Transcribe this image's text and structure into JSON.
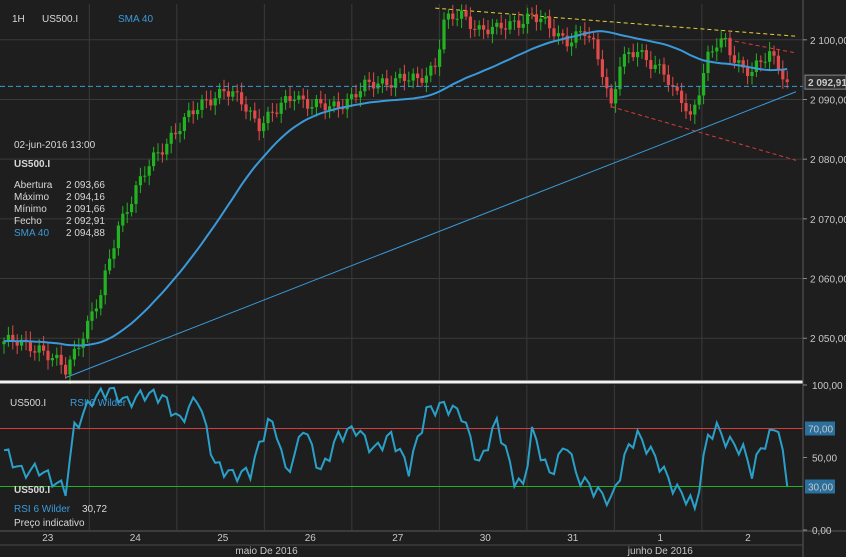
{
  "chart_data": [
    {
      "type": "candlestick",
      "timeframe": "1H",
      "symbol": "US500.I",
      "indicator": "SMA 40",
      "ylim": [
        2043,
        2106
      ],
      "yticks": [
        "2 100,00",
        "2 090,00",
        "2 080,00",
        "2 070,00",
        "2 060,00",
        "2 050,00"
      ],
      "ytick_values": [
        2100,
        2090,
        2080,
        2070,
        2060,
        2050
      ],
      "last_price_label": "2 092,91",
      "last_price": 2092.91,
      "reference_level": 2092.2,
      "x_day_labels": [
        "23",
        "24",
        "25",
        "26",
        "27",
        "30",
        "31",
        "1",
        "2"
      ],
      "x_month_labels": [
        "maio De 2016",
        "junho De 2016"
      ],
      "close_anchors": [
        [
          0,
          2049.5
        ],
        [
          8,
          2048.5
        ],
        [
          14,
          2044.5
        ],
        [
          18,
          2051
        ],
        [
          22,
          2057
        ],
        [
          26,
          2069
        ],
        [
          30,
          2075
        ],
        [
          34,
          2080
        ],
        [
          38,
          2084
        ],
        [
          42,
          2087
        ],
        [
          46,
          2090
        ],
        [
          50,
          2091.5
        ],
        [
          54,
          2089.5
        ],
        [
          58,
          2086
        ],
        [
          62,
          2088
        ],
        [
          66,
          2091
        ],
        [
          70,
          2089
        ],
        [
          74,
          2088.5
        ],
        [
          78,
          2090
        ],
        [
          82,
          2092
        ],
        [
          86,
          2093
        ],
        [
          90,
          2093.5
        ],
        [
          94,
          2093
        ],
        [
          98,
          2096
        ],
        [
          100,
          2103
        ],
        [
          104,
          2104
        ],
        [
          108,
          2102
        ],
        [
          112,
          2101.5
        ],
        [
          116,
          2103
        ],
        [
          120,
          2104
        ],
        [
          124,
          2102
        ],
        [
          128,
          2100
        ],
        [
          132,
          2101
        ],
        [
          134,
          2099
        ],
        [
          136,
          2095
        ],
        [
          138,
          2089
        ],
        [
          140,
          2096
        ],
        [
          144,
          2098
        ],
        [
          148,
          2096
        ],
        [
          150,
          2094.5
        ],
        [
          152,
          2091
        ],
        [
          154,
          2090
        ],
        [
          156,
          2087
        ],
        [
          158,
          2092
        ],
        [
          160,
          2097
        ],
        [
          162,
          2099
        ],
        [
          164,
          2099.5
        ],
        [
          166,
          2097
        ],
        [
          168,
          2095.5
        ],
        [
          170,
          2094.5
        ],
        [
          172,
          2096
        ],
        [
          174,
          2097.5
        ],
        [
          176,
          2096
        ],
        [
          178,
          2092.9
        ]
      ],
      "trendlines": [
        {
          "color": "#e6d23a",
          "style": "dashed",
          "from": [
            98,
            2105.3
          ],
          "to": [
            180,
            2100.6
          ]
        },
        {
          "color": "#d93a3a",
          "style": "dashed",
          "from": [
            163,
            2100.2
          ],
          "to": [
            180,
            2097.8
          ]
        },
        {
          "color": "#d93a3a",
          "style": "dashed",
          "from": [
            138,
            2088.8
          ],
          "to": [
            180,
            2079.8
          ]
        },
        {
          "color": "#3a9ad9",
          "style": "solid",
          "from": [
            14,
            2043.4
          ],
          "to": [
            180,
            2091.3
          ]
        }
      ],
      "series_colors": {
        "up": "#22b322",
        "down": "#e04a4a",
        "sma": "#3a9ad9"
      }
    },
    {
      "type": "line",
      "indicator": "RSI 6 Wilder",
      "symbol": "US500.I",
      "ylim": [
        0,
        100
      ],
      "yticks": [
        "100,00",
        "50,00",
        "0,00"
      ],
      "ytick_values": [
        100,
        50,
        0
      ],
      "levels": [
        {
          "value": 70,
          "label": "70,00",
          "color": "#d93a3a"
        },
        {
          "value": 30,
          "label": "30,00",
          "color": "#22b322"
        }
      ],
      "anchors": [
        [
          0,
          55
        ],
        [
          4,
          40
        ],
        [
          8,
          42
        ],
        [
          12,
          32
        ],
        [
          14,
          28
        ],
        [
          16,
          70
        ],
        [
          20,
          90
        ],
        [
          24,
          97
        ],
        [
          28,
          88
        ],
        [
          32,
          94
        ],
        [
          36,
          92
        ],
        [
          40,
          75
        ],
        [
          44,
          92
        ],
        [
          48,
          45
        ],
        [
          52,
          38
        ],
        [
          56,
          40
        ],
        [
          60,
          75
        ],
        [
          62,
          68
        ],
        [
          64,
          40
        ],
        [
          66,
          50
        ],
        [
          68,
          72
        ],
        [
          72,
          40
        ],
        [
          76,
          65
        ],
        [
          80,
          70
        ],
        [
          84,
          55
        ],
        [
          88,
          65
        ],
        [
          92,
          42
        ],
        [
          96,
          82
        ],
        [
          100,
          86
        ],
        [
          104,
          80
        ],
        [
          108,
          45
        ],
        [
          112,
          75
        ],
        [
          116,
          35
        ],
        [
          118,
          30
        ],
        [
          120,
          68
        ],
        [
          124,
          38
        ],
        [
          128,
          60
        ],
        [
          130,
          38
        ],
        [
          134,
          28
        ],
        [
          138,
          20
        ],
        [
          142,
          58
        ],
        [
          144,
          65
        ],
        [
          148,
          50
        ],
        [
          152,
          30
        ],
        [
          156,
          20
        ],
        [
          157,
          14
        ],
        [
          160,
          65
        ],
        [
          162,
          70
        ],
        [
          164,
          62
        ],
        [
          168,
          55
        ],
        [
          170,
          40
        ],
        [
          172,
          56
        ],
        [
          174,
          65
        ],
        [
          176,
          72
        ],
        [
          178,
          30
        ],
        [
          179,
          30.72
        ]
      ]
    }
  ],
  "info_panel": {
    "datetime": "02-jun-2016 13:00",
    "symbol": "US500.I",
    "rows": [
      {
        "label": "Abertura",
        "value": "2 093,66"
      },
      {
        "label": "Máximo",
        "value": "2 094,16"
      },
      {
        "label": "Mínimo",
        "value": "2 091,66"
      },
      {
        "label": "Fecho",
        "value": "2 092,91"
      }
    ],
    "sma_label": "SMA 40",
    "sma_value": "2 094,88",
    "rsi_symbol": "US500.I",
    "rsi_label": "RSI 6 Wilder",
    "rsi_value": "30,72",
    "price_note": "Preço indicativo"
  }
}
